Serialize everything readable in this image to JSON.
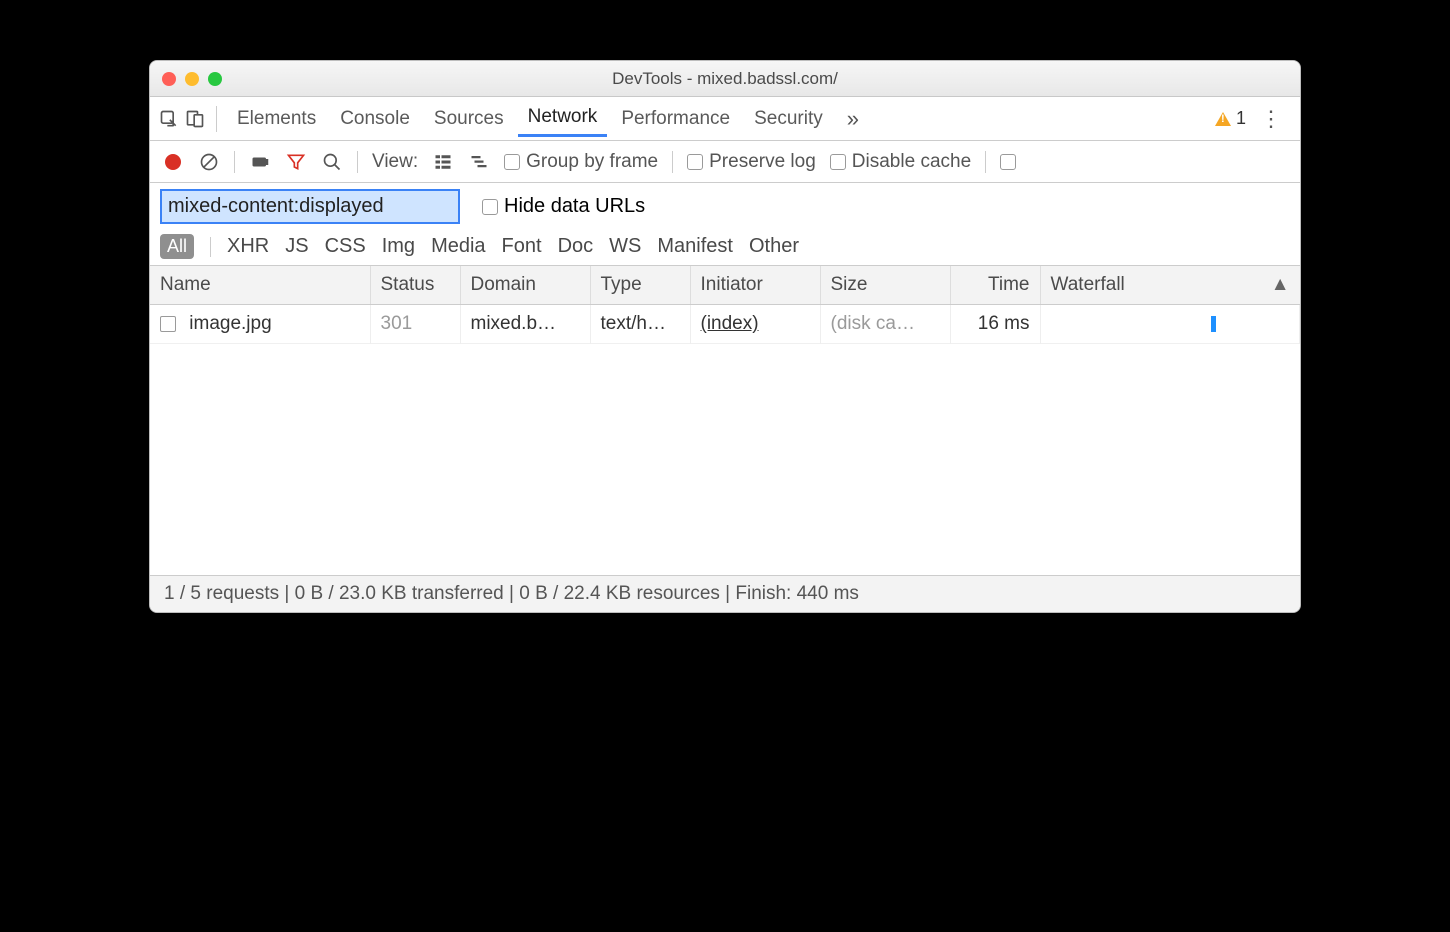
{
  "window": {
    "title": "DevTools - mixed.badssl.com/"
  },
  "tabs": {
    "items": [
      "Elements",
      "Console",
      "Sources",
      "Network",
      "Performance",
      "Security"
    ],
    "active": "Network",
    "warning_count": "1"
  },
  "toolbar": {
    "view_label": "View:",
    "group_by_frame": "Group by frame",
    "preserve_log": "Preserve log",
    "disable_cache": "Disable cache"
  },
  "filter": {
    "value": "mixed-content:displayed",
    "hide_data_urls": "Hide data URLs",
    "types": [
      "All",
      "XHR",
      "JS",
      "CSS",
      "Img",
      "Media",
      "Font",
      "Doc",
      "WS",
      "Manifest",
      "Other"
    ],
    "active_type": "All"
  },
  "table": {
    "columns": [
      "Name",
      "Status",
      "Domain",
      "Type",
      "Initiator",
      "Size",
      "Time",
      "Waterfall"
    ],
    "sorted_column": "Waterfall",
    "rows": [
      {
        "name": "image.jpg",
        "status": "301",
        "domain": "mixed.b…",
        "type": "text/h…",
        "initiator": "(index)",
        "size": "(disk ca…",
        "time": "16 ms"
      }
    ]
  },
  "status": {
    "text": "1 / 5 requests | 0 B / 23.0 KB transferred | 0 B / 22.4 KB resources | Finish: 440 ms"
  }
}
